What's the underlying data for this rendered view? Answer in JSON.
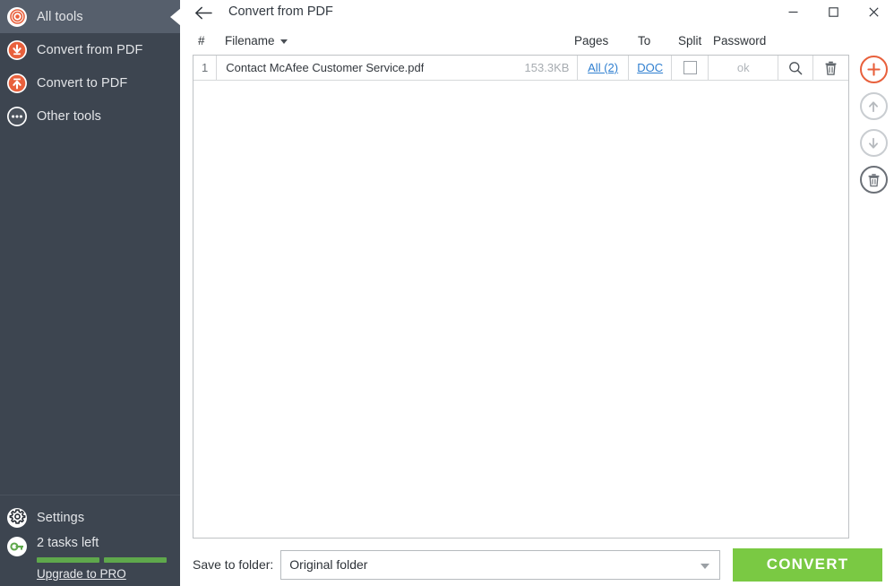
{
  "window": {
    "title": "Convert from PDF",
    "back_icon": "back-arrow-icon",
    "minimize": "–",
    "maximize": "□",
    "close": "✕"
  },
  "sidebar": {
    "items": [
      {
        "label": "All tools",
        "icon": "spiral-target-icon",
        "active": true
      },
      {
        "label": "Convert from PDF",
        "icon": "arrow-down-circle-icon",
        "active": false
      },
      {
        "label": "Convert to PDF",
        "icon": "arrow-up-circle-icon",
        "active": false
      },
      {
        "label": "Other tools",
        "icon": "ellipsis-icon",
        "active": false
      }
    ],
    "settings": {
      "label": "Settings",
      "icon": "gear-icon"
    },
    "tasks": {
      "label": "2 tasks left",
      "icon": "key-icon",
      "segments": 2,
      "upgrade_label": "Upgrade to PRO"
    }
  },
  "table": {
    "headers": {
      "number": "#",
      "filename": "Filename",
      "pages": "Pages",
      "to": "To",
      "split": "Split",
      "password": "Password"
    },
    "rows": [
      {
        "number": "1",
        "filename": "Contact McAfee Customer Service.pdf",
        "size": "153.3KB",
        "pages": "All (2)",
        "to": "DOC",
        "split_checked": false,
        "password": "ok",
        "search_icon": "magnifier-icon",
        "delete_icon": "trash-icon"
      }
    ]
  },
  "right_toolbar": [
    {
      "name": "add-files-button",
      "icon": "plus-icon",
      "state": "enabled"
    },
    {
      "name": "move-up-button",
      "icon": "arrow-up-icon",
      "state": "disabled"
    },
    {
      "name": "move-down-button",
      "icon": "arrow-down-icon",
      "state": "disabled"
    },
    {
      "name": "clear-list-button",
      "icon": "trash-icon",
      "state": "enabled"
    }
  ],
  "footer": {
    "save_to_label": "Save to folder:",
    "folder_value": "Original folder",
    "convert_label": "CONVERT"
  },
  "colors": {
    "sidebar_bg": "#3d4550",
    "sidebar_active": "#565f6c",
    "accent_orange": "#e8603c",
    "convert_green": "#7ac943",
    "progress_green": "#5fa84c",
    "link_blue": "#2f7fd0"
  }
}
